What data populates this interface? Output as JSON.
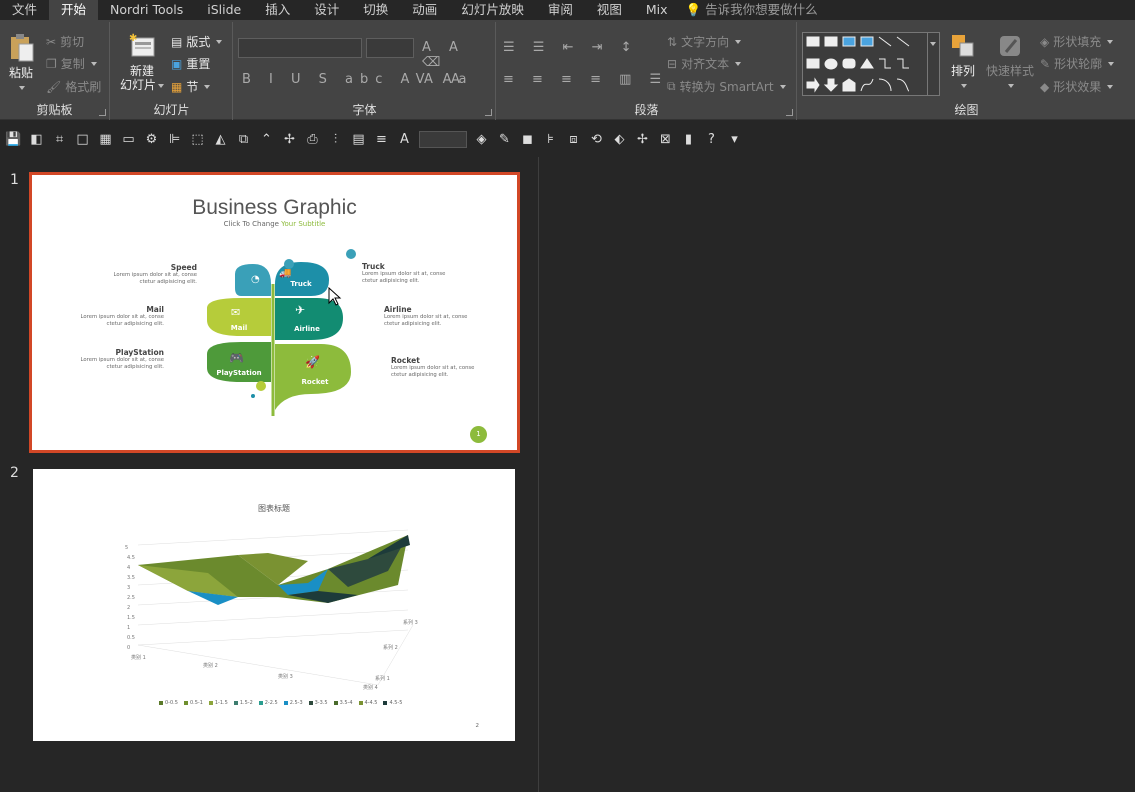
{
  "tabs": [
    "文件",
    "开始",
    "Nordri Tools",
    "iSlide",
    "插入",
    "设计",
    "切换",
    "动画",
    "幻灯片放映",
    "审阅",
    "视图",
    "Mix"
  ],
  "active_tab": "开始",
  "tell_me": "告诉我你想要做什么",
  "ribbon": {
    "clipboard": {
      "label": "剪贴板",
      "paste": "粘贴",
      "cut": "剪切",
      "copy": "复制",
      "format_painter": "格式刷"
    },
    "slides": {
      "label": "幻灯片",
      "new_slide_line1": "新建",
      "new_slide_line2": "幻灯片",
      "layout": "版式",
      "reset": "重置",
      "section": "节"
    },
    "font": {
      "label": "字体"
    },
    "paragraph": {
      "label": "段落",
      "text_direction": "文字方向",
      "align_text": "对齐文本",
      "smartart": "转换为 SmartArt"
    },
    "drawing": {
      "label": "绘图",
      "arrange": "排列",
      "quick_styles": "快速样式",
      "shape_fill": "形状填充",
      "shape_outline": "形状轮廓",
      "shape_effects": "形状效果"
    }
  },
  "slides": [
    {
      "number": "1",
      "title": "Business Graphic",
      "subtitle_prefix": "Click To Change ",
      "subtitle_highlight": "Your Subtitle",
      "items": [
        {
          "name": "Speed",
          "desc": "Lorem ipsum dolor sit at, conse ctetur adipisicing elit."
        },
        {
          "name": "Mail",
          "desc": "Lorem ipsum dolor sit at, conse ctetur adipisicing elit."
        },
        {
          "name": "PlayStation",
          "desc": "Lorem ipsum dolor sit at, conse ctetur adipisicing elit."
        },
        {
          "name": "Truck",
          "desc": "Lorem ipsum dolor sit at, conse ctetur adipisicing elit."
        },
        {
          "name": "Airline",
          "desc": "Lorem ipsum dolor sit at, conse ctetur adipisicing elit."
        },
        {
          "name": "Rocket",
          "desc": "Lorem ipsum dolor sit at, conse ctetur adipisicing elit."
        }
      ],
      "leaf_labels": {
        "truck": "Truck",
        "mail": "Mail",
        "airline": "Airline",
        "playstation": "PlayStation",
        "rocket": "Rocket"
      },
      "page_number": "1",
      "colors": {
        "teal": "#1d8fa8",
        "teal_dark": "#117a8b",
        "lime": "#b6cc3a",
        "green": "#128c72",
        "green_dark": "#4e9a3a",
        "olive": "#8dbb3c"
      }
    },
    {
      "number": "2",
      "chart_title": "图表标题",
      "y_ticks": [
        "5",
        "4.5",
        "4",
        "3.5",
        "3",
        "2.5",
        "2",
        "1.5",
        "1",
        "0.5",
        "0"
      ],
      "x_categories": [
        "类别 1",
        "类别 2",
        "类别 3",
        "类别 4"
      ],
      "depth_series": [
        "系列 1",
        "系列 2",
        "系列 3"
      ],
      "legend": [
        {
          "label": "0-0.5",
          "color": "#5b7a2a"
        },
        {
          "label": "0.5-1",
          "color": "#6f8f2e"
        },
        {
          "label": "1-1.5",
          "color": "#8ca53b"
        },
        {
          "label": "1.5-2",
          "color": "#3d7d6f"
        },
        {
          "label": "2-2.5",
          "color": "#2a9d8f"
        },
        {
          "label": "2.5-3",
          "color": "#1a8fc5"
        },
        {
          "label": "3-3.5",
          "color": "#2e4a3d"
        },
        {
          "label": "3.5-4",
          "color": "#4a6b2b"
        },
        {
          "label": "4-4.5",
          "color": "#7a9232"
        },
        {
          "label": "4.5-5",
          "color": "#1d3b3a"
        }
      ],
      "page_number": "2"
    }
  ]
}
